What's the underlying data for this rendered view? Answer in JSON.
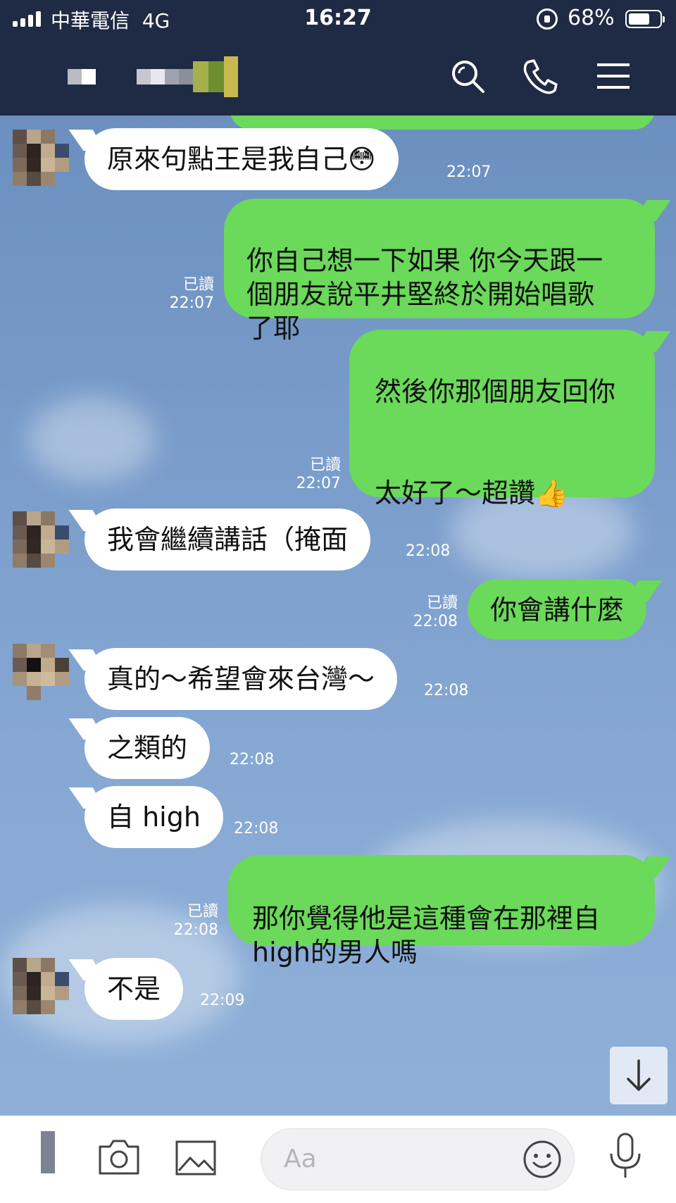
{
  "status": {
    "carrier": "中華電信",
    "network": "4G",
    "time": "16:27",
    "battery": "68%",
    "battery_level": 0.68
  },
  "colors": {
    "nav_bg": "#1f2a44",
    "outgoing_bubble": "#6bd95a",
    "incoming_bubble": "#ffffff",
    "chat_bg": "#7a9dcb"
  },
  "header": {
    "icons": [
      "search-icon",
      "phone-icon",
      "menu-icon"
    ]
  },
  "messages": [
    {
      "dir": "in",
      "text": "原來句點王是我自己😳",
      "time": "22:07"
    },
    {
      "dir": "out",
      "text": "你自己想一下如果 你今天跟一\n個朋友說平井堅終於開始唱歌\n了耶",
      "read": "已讀",
      "time": "22:07"
    },
    {
      "dir": "out",
      "text": "然後你那個朋友回你\n\n\n太好了～超讚👍",
      "read": "已讀",
      "time": "22:07"
    },
    {
      "dir": "in",
      "text": "我會繼續講話（掩面",
      "time": "22:08"
    },
    {
      "dir": "out",
      "text": "你會講什麼",
      "read": "已讀",
      "time": "22:08"
    },
    {
      "dir": "in",
      "text": "真的～希望會來台灣～",
      "time": "22:08"
    },
    {
      "dir": "in",
      "text": "之類的",
      "time": "22:08"
    },
    {
      "dir": "in",
      "text": "自 high",
      "time": "22:08"
    },
    {
      "dir": "out",
      "text": "那你覺得他是這種會在那裡自\nhigh的男人嗎",
      "read": "已讀",
      "time": "22:08"
    },
    {
      "dir": "in",
      "text": "不是",
      "time": "22:09"
    }
  ],
  "input": {
    "placeholder": "Aa",
    "icons": [
      "camera-icon",
      "image-icon",
      "emoji-icon",
      "microphone-icon"
    ]
  }
}
